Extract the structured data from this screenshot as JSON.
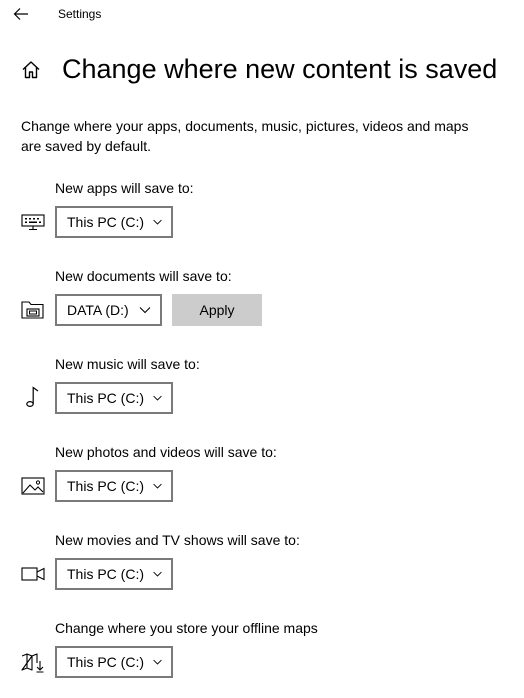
{
  "titlebar": {
    "title": "Settings",
    "back_icon": "back-arrow-icon"
  },
  "header": {
    "home_icon": "home-icon",
    "title": "Change where new content is saved"
  },
  "description": "Change where your apps, documents, music, pictures, videos and maps are saved by default.",
  "sections": [
    {
      "label": "New apps will save to:",
      "icon": "keyboard-icon",
      "value": "This PC (C:)"
    },
    {
      "label": "New documents will save to:",
      "icon": "folder-drive-icon",
      "value": "DATA (D:)",
      "apply_label": "Apply"
    },
    {
      "label": "New music will save to:",
      "icon": "music-note-icon",
      "value": "This PC (C:)"
    },
    {
      "label": "New photos and videos will save to:",
      "icon": "photo-icon",
      "value": "This PC (C:)"
    },
    {
      "label": "New movies and TV shows will save to:",
      "icon": "video-camera-icon",
      "value": "This PC (C:)"
    },
    {
      "label": "Change where you store your offline maps",
      "icon": "map-download-icon",
      "value": "This PC (C:)"
    }
  ],
  "colors": {
    "dropdown_border": "#7a7a7a",
    "apply_button_bg": "#cccccc",
    "text": "#000000"
  }
}
